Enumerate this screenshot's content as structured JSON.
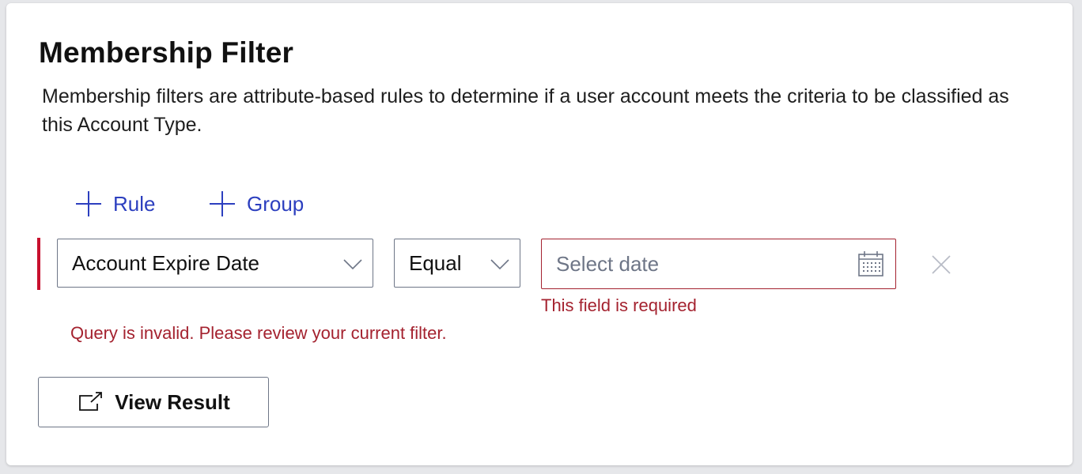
{
  "section": {
    "title": "Membership Filter",
    "description": "Membership filters are attribute-based rules to determine if a user account meets the criteria to be classified as this Account Type."
  },
  "actions": {
    "add_rule_label": "Rule",
    "add_group_label": "Group"
  },
  "rule": {
    "field_value": "Account Expire Date",
    "operator_value": "Equal",
    "date_placeholder": "Select date",
    "date_value": "",
    "field_error": "This field is required"
  },
  "query_error": "Query is invalid. Please review your current filter.",
  "view_result_label": "View Result",
  "icons": {
    "add": "plus-icon",
    "dropdown": "chevron-down-icon",
    "calendar": "calendar-icon",
    "remove": "close-icon",
    "view": "external-link-icon"
  },
  "colors": {
    "accent": "#2c3fbf",
    "error": "#a4222f",
    "rule_bar": "#c8102e",
    "border": "#6e7687"
  }
}
